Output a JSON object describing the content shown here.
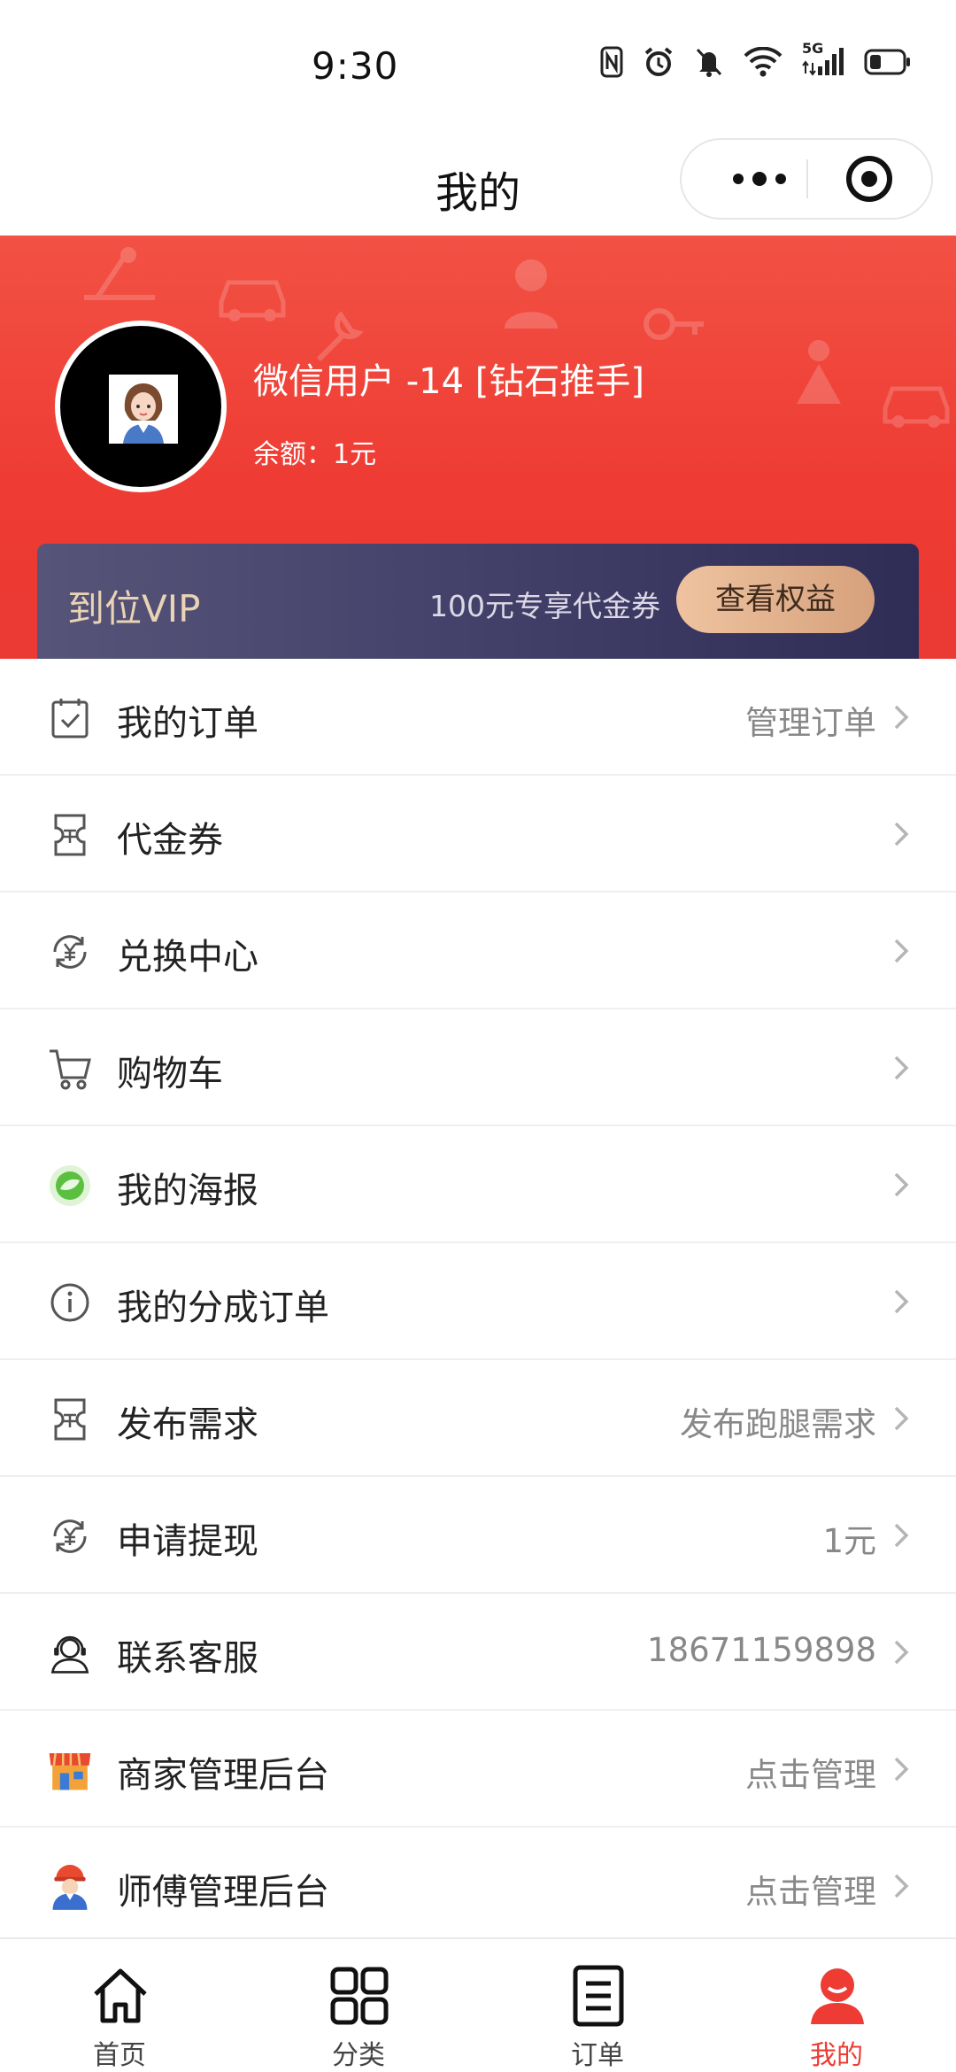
{
  "status_bar": {
    "time": "9:30",
    "network": "5G"
  },
  "title_bar": {
    "title": "我的"
  },
  "profile": {
    "username": "微信用户 -14 [钻石推手]",
    "balance": "余额：1元"
  },
  "vip": {
    "title": "到位VIP",
    "desc": "100元专享代金券",
    "button": "查看权益"
  },
  "menu": [
    {
      "label": "我的订单",
      "value": "管理订单",
      "icon": "order-check-icon"
    },
    {
      "label": "代金券",
      "value": "",
      "icon": "voucher-icon"
    },
    {
      "label": "兑换中心",
      "value": "",
      "icon": "exchange-yen-icon"
    },
    {
      "label": "购物车",
      "value": "",
      "icon": "cart-icon"
    },
    {
      "label": "我的海报",
      "value": "",
      "icon": "poster-leaf-icon"
    },
    {
      "label": "我的分成订单",
      "value": "",
      "icon": "info-icon"
    },
    {
      "label": "发布需求",
      "value": "发布跑腿需求",
      "icon": "voucher-icon"
    },
    {
      "label": "申请提现",
      "value": "1元",
      "icon": "exchange-yen-icon"
    },
    {
      "label": "联系客服",
      "value": "18671159898",
      "icon": "customer-service-icon"
    },
    {
      "label": "商家管理后台",
      "value": "点击管理",
      "icon": "shop-icon"
    },
    {
      "label": "师傅管理后台",
      "value": "点击管理",
      "icon": "worker-icon"
    }
  ],
  "tabs": [
    {
      "label": "首页",
      "icon": "home-icon"
    },
    {
      "label": "分类",
      "icon": "category-icon"
    },
    {
      "label": "订单",
      "icon": "order-list-icon"
    },
    {
      "label": "我的",
      "icon": "user-icon"
    }
  ],
  "colors": {
    "accent": "#ee3b33",
    "vip_bg": "#43416a",
    "vip_gold": "#ead3b4"
  }
}
